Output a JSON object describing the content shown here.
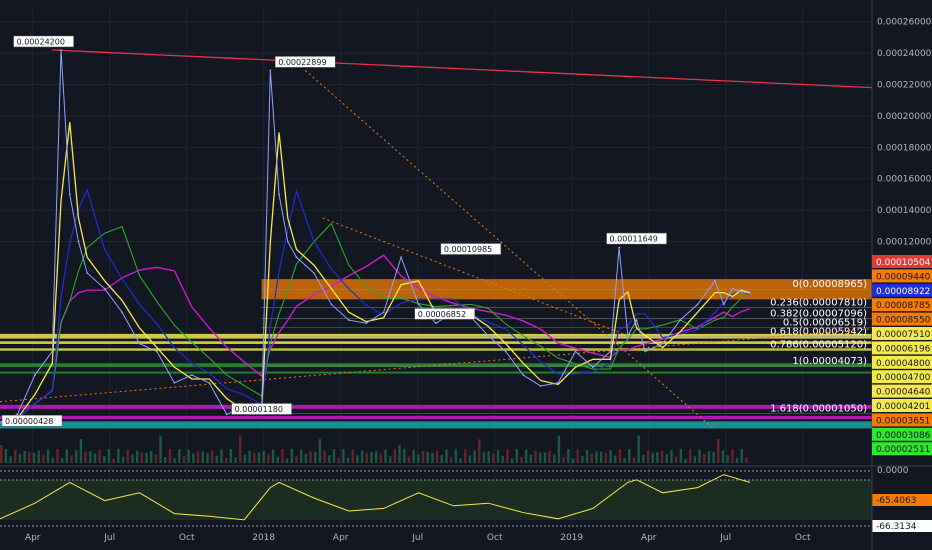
{
  "chart_data": {
    "type": "line",
    "title": "",
    "price_axis": {
      "ticks": [
        "0.00026000",
        "0.00024000",
        "0.00022000",
        "0.00020000",
        "0.00018000",
        "0.00016000",
        "0.00014000",
        "0.00012000"
      ],
      "ylim": [
        0,
        0.00027
      ]
    },
    "time_axis": {
      "labels": [
        "Apr",
        "Jul",
        "Oct",
        "2018",
        "Apr",
        "Jul",
        "Oct",
        "2019",
        "Apr",
        "Jul",
        "Oct"
      ]
    },
    "price_badges": [
      {
        "text": "0.00010504",
        "color": "#e53935"
      },
      {
        "text": "0.00009440",
        "color": "#f57c00"
      },
      {
        "text": "0.00008922",
        "color": "#1e2fd6"
      },
      {
        "text": "0.00008785",
        "color": "#f57c00"
      },
      {
        "text": "0.00008550",
        "color": "#f57c00"
      },
      {
        "text": "0.00007510",
        "color": "#f5e94b"
      },
      {
        "text": "0.00006196",
        "color": "#f5e94b"
      },
      {
        "text": "0.00004800",
        "color": "#f5e94b"
      },
      {
        "text": "0.00004700",
        "color": "#f5e94b"
      },
      {
        "text": "0.00004640",
        "color": "#f5e94b"
      },
      {
        "text": "0.00004201",
        "color": "#f5e94b"
      },
      {
        "text": "0.00003651",
        "color": "#f57c00"
      },
      {
        "text": "0.00003086",
        "color": "#2ee82e"
      },
      {
        "text": "0.00002511",
        "color": "#2ee82e"
      }
    ],
    "fib_levels": [
      {
        "label": "0(0.00008965)",
        "value": 8.965e-05
      },
      {
        "label": "0.236(0.00007810)",
        "value": 7.81e-05
      },
      {
        "label": "0.382(0.00007096)",
        "value": 7.096e-05
      },
      {
        "label": "0.5(0.00006519)",
        "value": 6.519e-05
      },
      {
        "label": "0.618(0.00005942)",
        "value": 5.942e-05
      },
      {
        "label": "0.786(0.00005120)",
        "value": 5.12e-05
      },
      {
        "label": "1(0.00004073)",
        "value": 4.073e-05
      },
      {
        "label": "1.618(0.00001050)",
        "value": 1.05e-05
      }
    ],
    "peak_labels": [
      {
        "text": "0.00024200",
        "t": 0.05,
        "value": 0.000242
      },
      {
        "text": "0.00022899",
        "t": 0.35,
        "value": 0.00022899
      },
      {
        "text": "0.00010985",
        "t": 0.54,
        "value": 0.00010985
      },
      {
        "text": "0.00011649",
        "t": 0.73,
        "value": 0.00011649
      },
      {
        "text": "0.00006852",
        "t": 0.51,
        "value": 6.852e-05
      },
      {
        "text": "0.00001180",
        "t": 0.3,
        "value": 1.18e-05
      },
      {
        "text": "0.00000428",
        "t": 0.0,
        "value": 4.28e-06
      }
    ],
    "price_series": {
      "name": "",
      "t": [
        0.0,
        0.02,
        0.04,
        0.06,
        0.07,
        0.08,
        0.09,
        0.1,
        0.12,
        0.14,
        0.16,
        0.18,
        0.2,
        0.22,
        0.24,
        0.26,
        0.28,
        0.3,
        0.31,
        0.32,
        0.33,
        0.34,
        0.36,
        0.38,
        0.4,
        0.42,
        0.44,
        0.46,
        0.48,
        0.5,
        0.52,
        0.54,
        0.56,
        0.58,
        0.6,
        0.62,
        0.64,
        0.66,
        0.68,
        0.7,
        0.71,
        0.72,
        0.73,
        0.74,
        0.76,
        0.78,
        0.8,
        0.82,
        0.83,
        0.84,
        0.85,
        0.86
      ],
      "values": [
        5e-06,
        1e-05,
        3.5e-05,
        5e-05,
        0.000242,
        0.00015,
        0.00012,
        0.0001,
        9e-05,
        7.5e-05,
        5.5e-05,
        5e-05,
        3e-05,
        3.5e-05,
        3e-05,
        1e-05,
        1.5e-05,
        1e-05,
        0.000229,
        0.00015,
        0.00012,
        0.00011,
        0.0001,
        8e-05,
        7e-05,
        6.8e-05,
        7.5e-05,
        0.00011,
        8e-05,
        6.8e-05,
        7.5e-05,
        7.2e-05,
        6e-05,
        5e-05,
        3.5e-05,
        2.8e-05,
        3e-05,
        5e-05,
        4e-05,
        5e-05,
        0.000116,
        6e-05,
        7e-05,
        5e-05,
        5.5e-05,
        7e-05,
        8e-05,
        9.5e-05,
        8e-05,
        9e-05,
        8.8e-05,
        8.7e-05
      ]
    },
    "oscillator": {
      "name": "",
      "levels": [
        "0.0000",
        "-65.4063",
        "-66.3134"
      ],
      "t": [
        0.0,
        0.04,
        0.08,
        0.12,
        0.16,
        0.2,
        0.24,
        0.28,
        0.31,
        0.32,
        0.36,
        0.4,
        0.44,
        0.48,
        0.52,
        0.56,
        0.6,
        0.64,
        0.68,
        0.72,
        0.73,
        0.76,
        0.8,
        0.83,
        0.86
      ],
      "values": [
        -90,
        -60,
        -20,
        -55,
        -40,
        -80,
        -85,
        -92,
        -30,
        -20,
        -50,
        -75,
        -70,
        -40,
        -65,
        -60,
        -78,
        -90,
        -70,
        -20,
        -15,
        -40,
        -30,
        -5,
        -20
      ]
    }
  },
  "colors": {
    "background": "#131722",
    "candle": "#8fa3ff",
    "ma_yellow": "#f5e94b",
    "ma_blue": "#1e2fd6",
    "ma_green": "#2ea72e",
    "ma_magenta": "#d019d0",
    "trend_red": "#e8344e",
    "fib_orange": "#f57c00",
    "band_teal": "#1aa5a5"
  }
}
